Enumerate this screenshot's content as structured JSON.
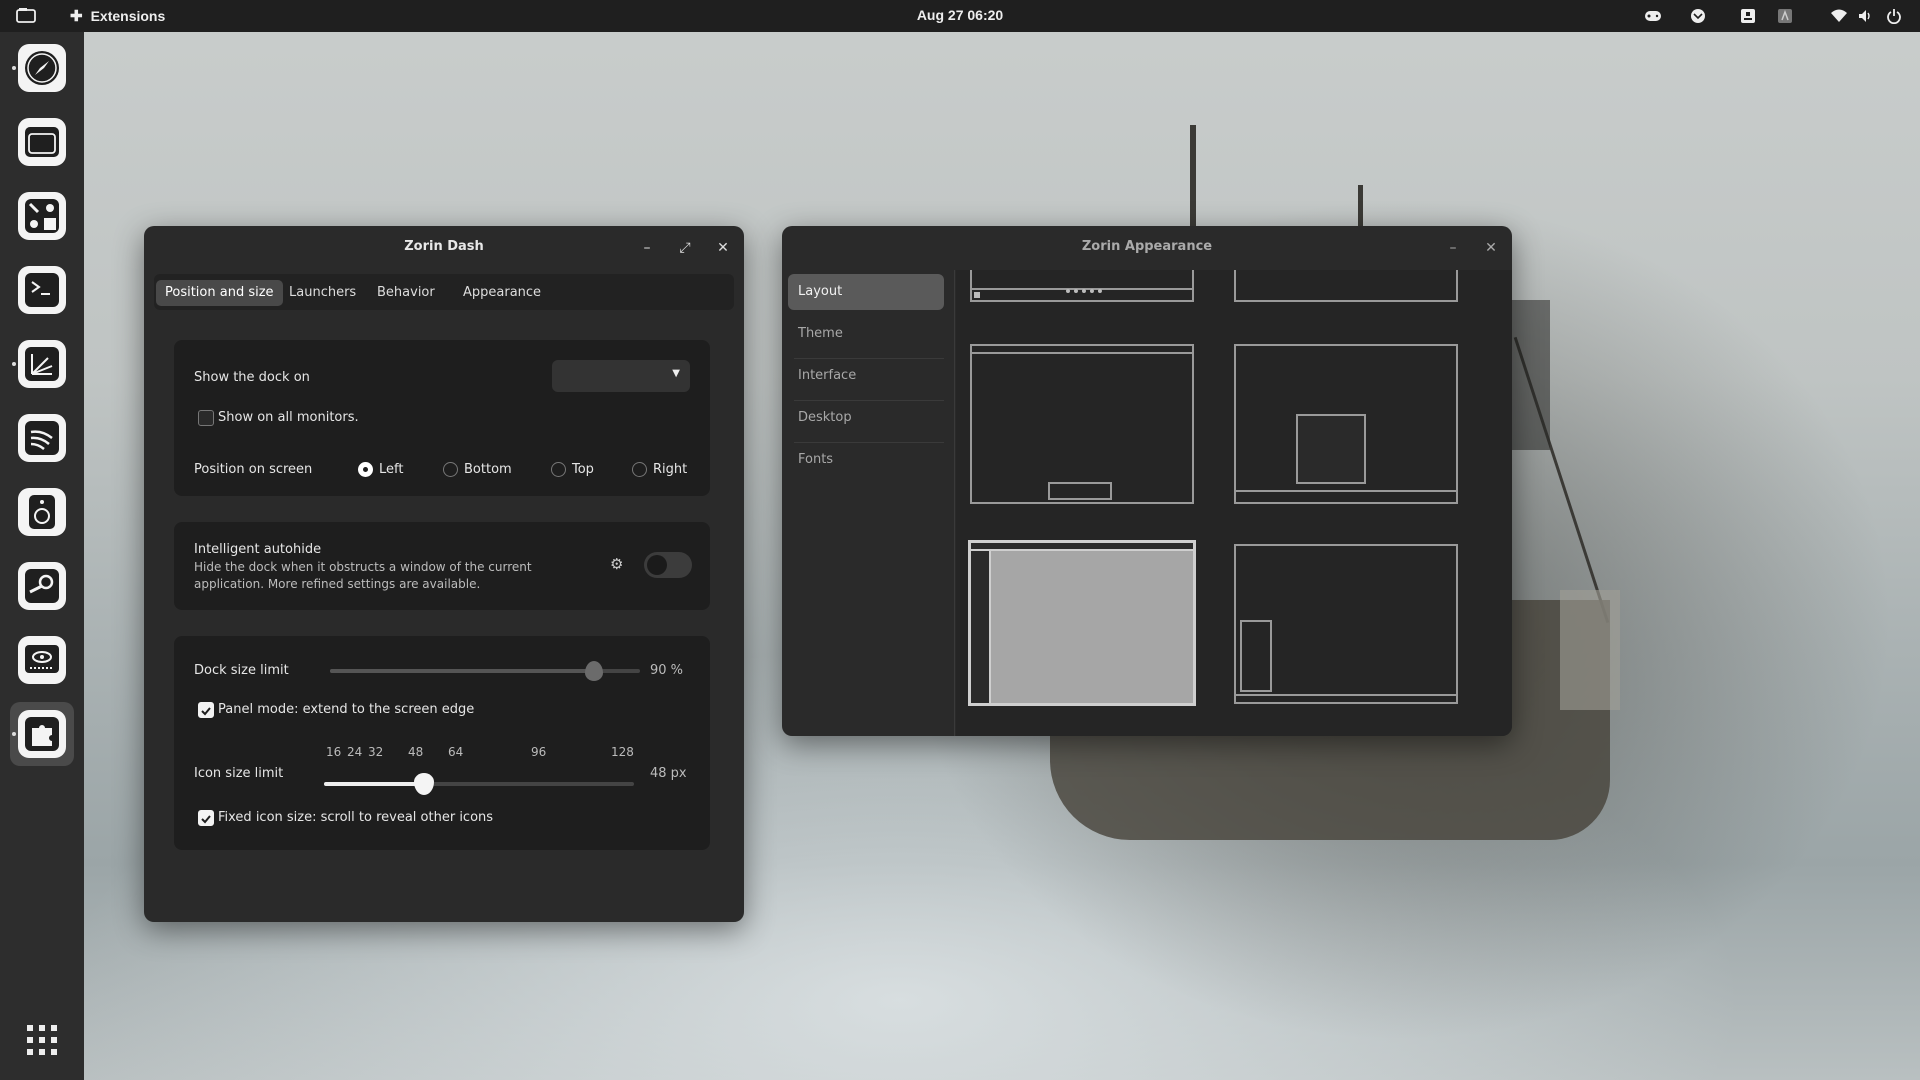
{
  "topbar": {
    "activities_icon": "activities-icon",
    "app_name": "Extensions",
    "clock": "Aug 27  06:20",
    "tray_icons": [
      "gamepad-icon",
      "mail-icon",
      "notes-icon",
      "keyboard-icon",
      "wifi-icon",
      "volume-icon",
      "power-icon"
    ]
  },
  "dock": {
    "items": [
      "compass-app",
      "window-app",
      "settings-app",
      "terminal-app",
      "image-app",
      "rss-app",
      "speaker-app",
      "steam-app",
      "nvidia-app",
      "extensions-app"
    ],
    "apps_grid_icon": "app-grid-icon"
  },
  "zorin_dash": {
    "title": "Zorin Dash",
    "tabs": [
      "Position and size",
      "Launchers",
      "Behavior",
      "Appearance"
    ],
    "show_dock_on_label": "Show the dock on",
    "show_dock_on_value": "",
    "show_all_monitors": "Show on all monitors.",
    "position_label": "Position on screen",
    "positions": [
      "Left",
      "Bottom",
      "Top",
      "Right"
    ],
    "selected_position": "Left",
    "autohide_title": "Intelligent autohide",
    "autohide_desc_1": "Hide the dock when it obstructs a window of the current",
    "autohide_desc_2": "application. More refined settings are available.",
    "autohide_enabled": false,
    "dock_size_label": "Dock size limit",
    "dock_size_value": "90 %",
    "dock_size_fraction": 0.85,
    "panel_mode": "Panel mode: extend to the screen edge",
    "panel_mode_checked": true,
    "icon_size_label": "Icon size limit",
    "icon_size_ticks": [
      "16",
      "24",
      "32",
      "48",
      "64",
      "96",
      "128"
    ],
    "icon_size_value": "48 px",
    "fixed_icon": "Fixed icon size: scroll to reveal other icons",
    "fixed_icon_checked": true
  },
  "zorin_appearance": {
    "title": "Zorin Appearance",
    "sidebar": [
      "Layout",
      "Theme",
      "Interface",
      "Desktop",
      "Fonts"
    ],
    "selected": "Layout"
  }
}
